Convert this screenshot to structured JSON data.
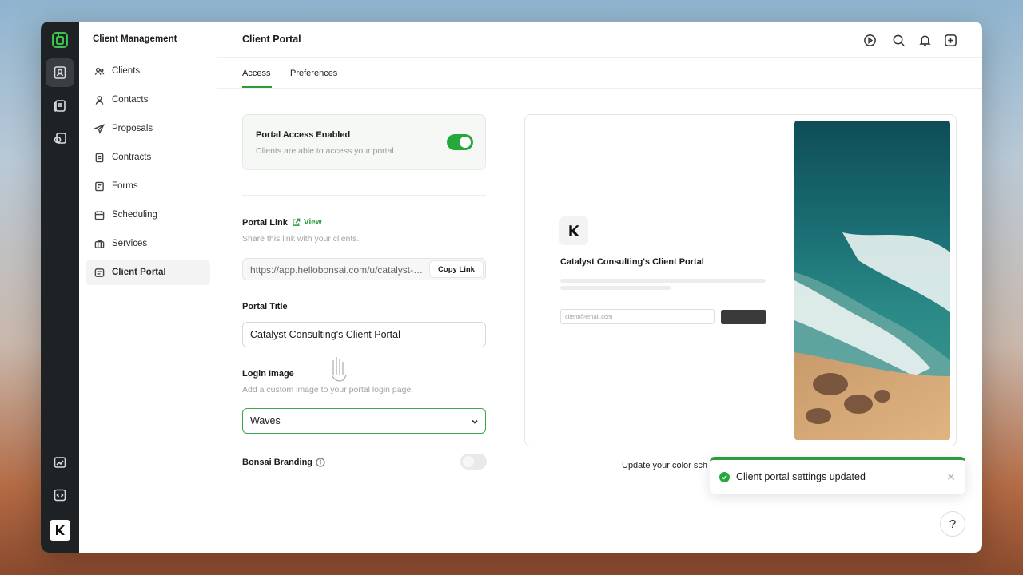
{
  "sidebar": {
    "title": "Client Management",
    "items": [
      {
        "label": "Clients"
      },
      {
        "label": "Contacts"
      },
      {
        "label": "Proposals"
      },
      {
        "label": "Contracts"
      },
      {
        "label": "Forms"
      },
      {
        "label": "Scheduling"
      },
      {
        "label": "Services"
      },
      {
        "label": "Client Portal"
      }
    ]
  },
  "header": {
    "title": "Client Portal",
    "icons": [
      "play-icon",
      "search-icon",
      "bell-icon",
      "add-icon"
    ]
  },
  "tabs": [
    {
      "label": "Access",
      "active": true
    },
    {
      "label": "Preferences",
      "active": false
    }
  ],
  "access": {
    "card_title": "Portal Access Enabled",
    "card_subtitle": "Clients are able to access your portal.",
    "portal_access_enabled": true,
    "portal_link_label": "Portal Link",
    "view_label": "View",
    "portal_link_help": "Share this link with your clients.",
    "portal_link_value": "https://app.hellobonsai.com/u/catalyst-consulting",
    "copy_link_label": "Copy Link",
    "portal_title_label": "Portal Title",
    "portal_title_value": "Catalyst Consulting's Client Portal",
    "login_image_label": "Login Image",
    "login_image_help": "Add a custom image to your portal login page.",
    "login_image_value": "Waves",
    "branding_label": "Bonsai Branding",
    "branding_enabled": false
  },
  "preview": {
    "title": "Catalyst Consulting's Client Portal",
    "email_placeholder": "client@email.com",
    "color_note": "Update your color sch"
  },
  "toast": {
    "message": "Client portal settings updated",
    "close": "✕"
  },
  "help_button": "?",
  "colors": {
    "accent": "#2e9a3b",
    "rail": "#1f2225"
  }
}
